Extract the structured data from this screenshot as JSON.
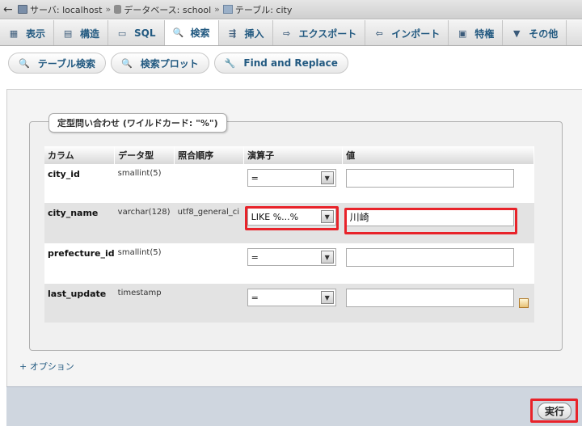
{
  "breadcrumb": {
    "back": "←",
    "server": "サーバ: localhost",
    "database": "データベース: school",
    "table": "テーブル: city",
    "separator": "»"
  },
  "tabs": [
    {
      "label": "表示",
      "icon": "browse-icon"
    },
    {
      "label": "構造",
      "icon": "structure-icon"
    },
    {
      "label": "SQL",
      "icon": "sql-icon"
    },
    {
      "label": "検索",
      "icon": "search-icon",
      "active": true
    },
    {
      "label": "挿入",
      "icon": "insert-icon"
    },
    {
      "label": "エクスポート",
      "icon": "export-icon"
    },
    {
      "label": "インポート",
      "icon": "import-icon"
    },
    {
      "label": "特権",
      "icon": "privileges-icon"
    },
    {
      "label": "その他",
      "icon": "chevron-down-icon"
    }
  ],
  "subtabs": [
    {
      "label": "テーブル検索",
      "icon": "search-icon"
    },
    {
      "label": "検索プロット",
      "icon": "search-icon"
    },
    {
      "label": "Find and Replace",
      "icon": "wrench-icon"
    }
  ],
  "form": {
    "legend": "定型問い合わせ (ワイルドカード: \"%\")",
    "headers": {
      "column": "カラム",
      "type": "データ型",
      "collation": "照合順序",
      "operator": "演算子",
      "value": "値"
    },
    "rows": [
      {
        "column": "city_id",
        "type": "smallint(5)",
        "collation": "",
        "operator": "=",
        "value": ""
      },
      {
        "column": "city_name",
        "type": "varchar(128)",
        "collation": "utf8_general_ci",
        "operator": "LIKE %...%",
        "value": "川崎"
      },
      {
        "column": "prefecture_id",
        "type": "smallint(5)",
        "collation": "",
        "operator": "=",
        "value": ""
      },
      {
        "column": "last_update",
        "type": "timestamp",
        "collation": "",
        "operator": "=",
        "value": ""
      }
    ],
    "options_link": "+ オプション",
    "submit": "実行"
  },
  "colors": {
    "highlight": "#e8232a",
    "link": "#235a81"
  }
}
